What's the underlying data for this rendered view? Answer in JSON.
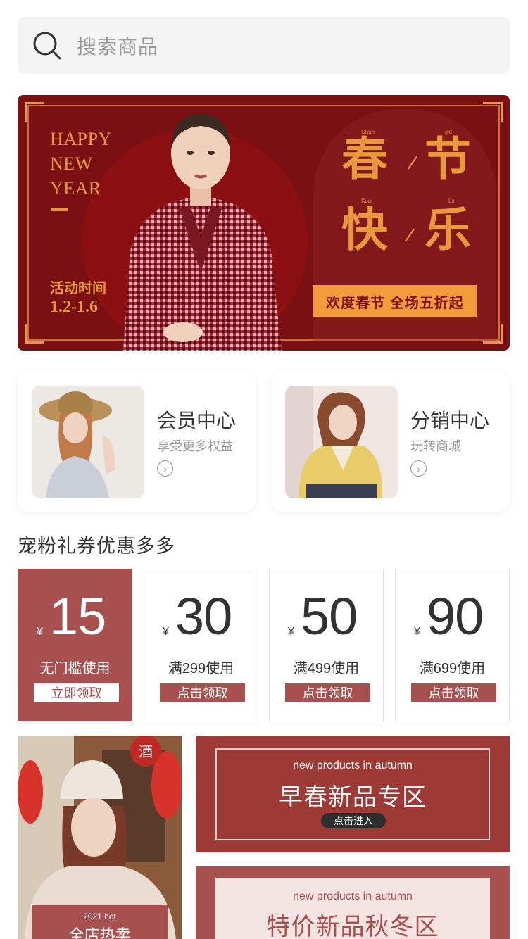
{
  "search": {
    "placeholder": "搜索商品"
  },
  "banner": {
    "happy_text": "HAPPY\nNEW\nYEAR",
    "activity_label": "活动时间",
    "activity_dates": "1.2-1.6",
    "greeting": [
      "春",
      "节",
      "快",
      "乐"
    ],
    "pinyin": [
      "Chun",
      "Jie",
      "Kuai",
      "Le"
    ],
    "sale_text": "欢度春节 全场五折起",
    "colors": {
      "background": "#7a1014",
      "accent": "#e9993d",
      "button": "#f29b3b"
    }
  },
  "cards": [
    {
      "title": "会员中心",
      "subtitle": "享受更多权益",
      "arrow": "chevron-right-icon"
    },
    {
      "title": "分销中心",
      "subtitle": "玩转商城",
      "arrow": "chevron-right-icon"
    }
  ],
  "coupons": {
    "title": "宠粉礼券优惠多多",
    "currency": "¥",
    "items": [
      {
        "amount": "15",
        "condition": "无门槛使用",
        "button": "立即领取",
        "active": true
      },
      {
        "amount": "30",
        "condition": "满299使用",
        "button": "点击领取",
        "active": false
      },
      {
        "amount": "50",
        "condition": "满499使用",
        "button": "点击领取",
        "active": false
      },
      {
        "amount": "90",
        "condition": "满699使用",
        "button": "点击领取",
        "active": false
      }
    ],
    "colors": {
      "accent": "#a84f4f"
    }
  },
  "promos": {
    "left": {
      "small": "2021 hot",
      "title": "全店热卖"
    },
    "right_top": {
      "en": "new products in autumn",
      "title": "早春新品专区",
      "button": "点击进入"
    },
    "right_bottom": {
      "en": "new products in autumn",
      "title": "特价新品秋冬区"
    }
  }
}
